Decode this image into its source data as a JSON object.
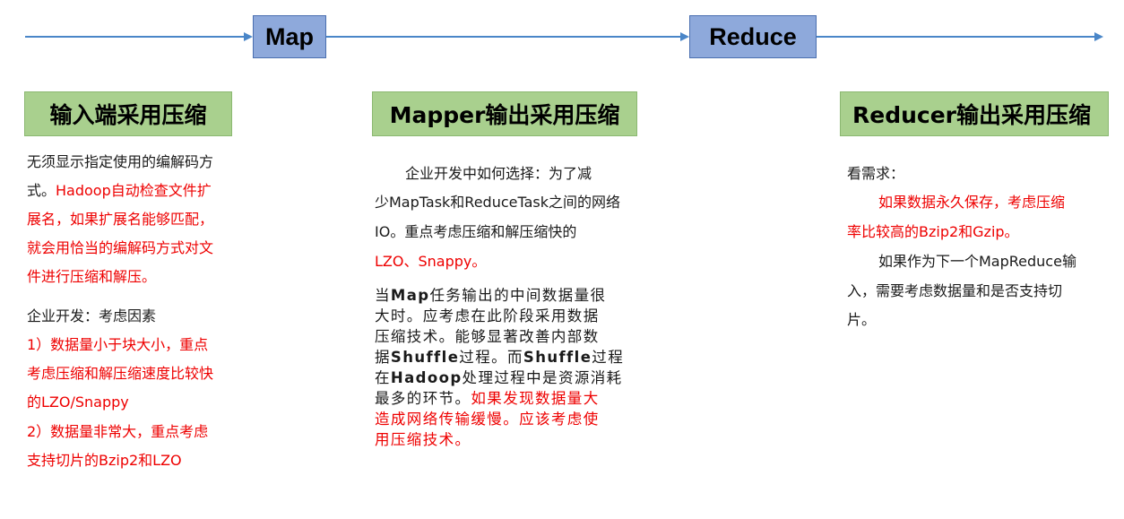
{
  "stages": {
    "map": "Map",
    "reduce": "Reduce"
  },
  "colors": {
    "arrow": "#4a86c8",
    "stage_fill": "#8ea9db",
    "header_fill": "#a9d08e",
    "highlight": "#ee0000"
  },
  "input_col": {
    "title": "输入端采用压缩",
    "p1_line1": "无须显示指定使用的编解码方",
    "p1_line2_black": "式。",
    "p1_line2_red": "Hadoop自动检查文件扩",
    "p1_line3": "展名，如果扩展名能够匹配，",
    "p1_line4": "就会用恰当的编解码方式对文",
    "p1_line5": "件进行压缩和解压。",
    "p2_label": "企业开发：考虑因素",
    "p2_item1_line1": "1）数据量小于块大小，重点",
    "p2_item1_line2": "考虑压缩和解压缩速度比较快",
    "p2_item1_line3": "的LZO/Snappy",
    "p2_item2_line1": "2）数据量非常大，重点考虑",
    "p2_item2_line2": "支持切片的Bzip2和LZO"
  },
  "mapper_col": {
    "title": "Mapper输出采用压缩",
    "p1_line1": "企业开发中如何选择：为了减",
    "p1_line2": "少MapTask和ReduceTask之间的网络",
    "p1_line3": "IO。重点考虑压缩和解压缩快的",
    "p1_line4": "LZO、Snappy。",
    "p2_line1_a": "当",
    "p2_line1_b": "Map",
    "p2_line1_c": "任务输出的中间数据量很",
    "p2_line2": "大时。应考虑在此阶段采用数据",
    "p2_line3": "压缩技术。能够显著改善内部数",
    "p2_line4_a": "据",
    "p2_line4_b": "Shuffle",
    "p2_line4_c": "过程。而",
    "p2_line4_d": "Shuffle",
    "p2_line4_e": "过程",
    "p2_line5_a": "在",
    "p2_line5_b": "Hadoop",
    "p2_line5_c": "处理过程中是资源消耗",
    "p2_line6_black": "最多的环节。",
    "p2_line6_red": "如果发现数据量大",
    "p2_line7": "造成网络传输缓慢。应该考虑使",
    "p2_line8": "用压缩技术。"
  },
  "reducer_col": {
    "title": "Reducer输出采用压缩",
    "p0": "看需求：",
    "p1_line1": "如果数据永久保存，考虑压缩",
    "p1_line2": "率比较高的Bzip2和Gzip。",
    "p2_line1": "如果作为下一个MapReduce输",
    "p2_line2": "入，需要考虑数据量和是否支持切",
    "p2_line3": "片。"
  }
}
